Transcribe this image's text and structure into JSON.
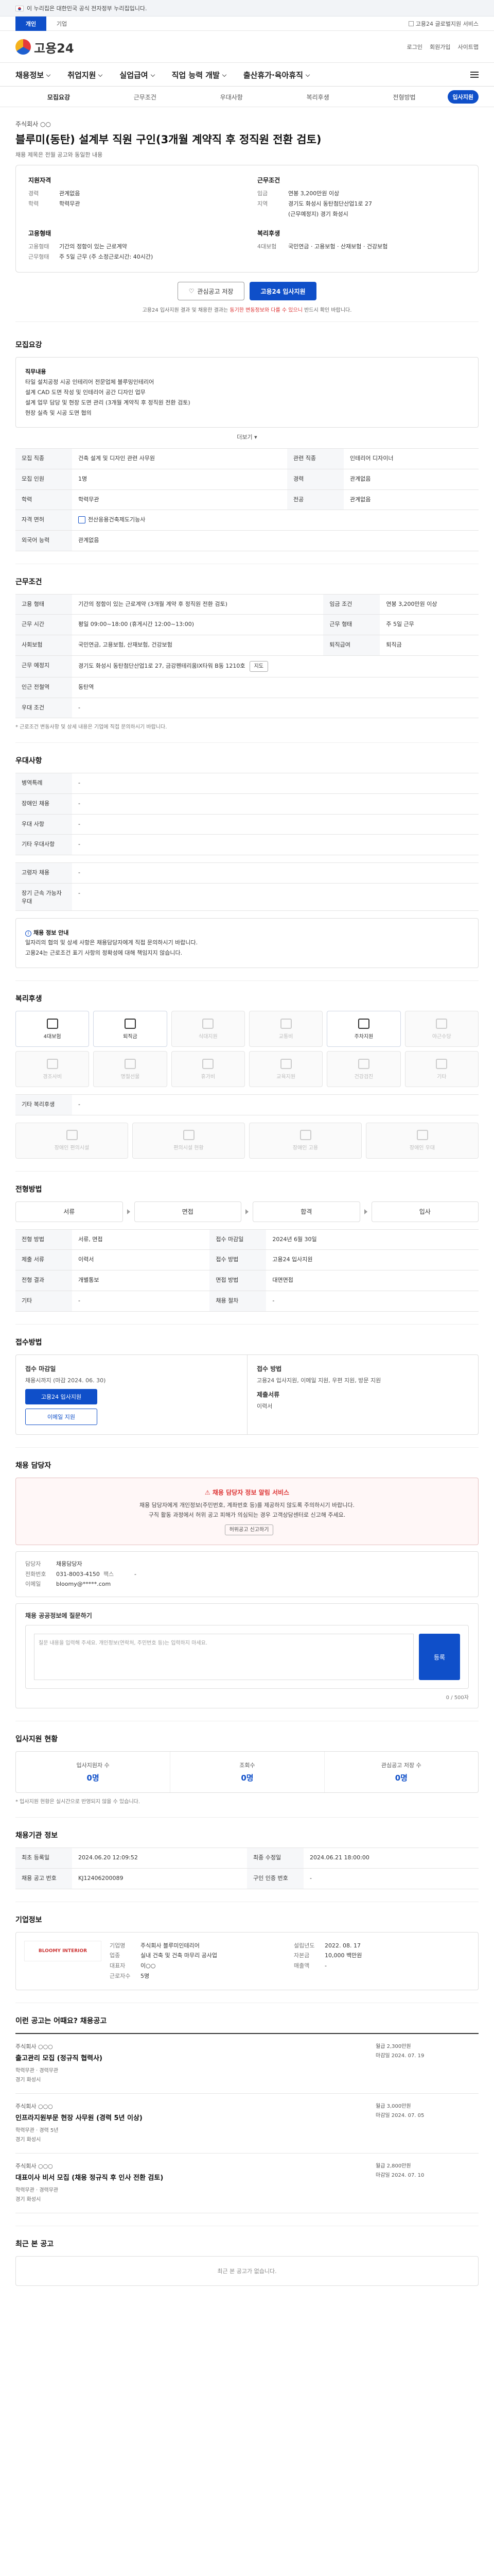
{
  "gov_banner": "이 누리집은 대한민국 공식 전자정부 누리집입니다.",
  "top_tabs": [
    "개인",
    "기업"
  ],
  "top_right": "고용24 글로벌지원 서비스",
  "logo_text": "고용24",
  "header_links": [
    "로그인",
    "회원가입",
    "사이트맵"
  ],
  "gnb": [
    "채용정보",
    "취업지원",
    "실업급여",
    "직업 능력 개발",
    "출산휴가·육아휴직"
  ],
  "sub_tabs": [
    "모집요강",
    "근무조건",
    "우대사항",
    "복리후생",
    "전형방법"
  ],
  "apply_top": "입사지원",
  "company_name": "주식회사 ○○",
  "job_title": "블루미(동탄) 설계부 직원 구인(3개월 계약직 후 정직원 전환 검토)",
  "job_sub": "채용 제목은 전월 공고와 동일한 내용",
  "summary": {
    "left_title": "지원자격",
    "left_rows": [
      {
        "k": "경력",
        "v": "관계없음"
      },
      {
        "k": "학력",
        "v": "학력무관"
      }
    ],
    "right_title": "근무조건",
    "right_rows": [
      {
        "k": "임금",
        "v": "연봉 3,200만원 이상"
      },
      {
        "k": "지역",
        "v": "경기도 화성시 동탄첨단산업1로 27"
      },
      {
        "k": "",
        "v": "(근무예정지) 경기 화성시"
      }
    ],
    "left_title2": "고용형태",
    "left_rows2": [
      {
        "k": "고용형태",
        "v": "기간의 정함이 있는 근로계약"
      },
      {
        "k": "근무형태",
        "v": "주 5일 근무 (주 소정근로시간: 40시간)"
      }
    ],
    "right_title2": "복리후생",
    "right_rows2": [
      {
        "k": "4대보험",
        "v": "국민연금 · 고용보험 · 산재보험 · 건강보험"
      }
    ]
  },
  "btn_scrap": "관심공고 저장",
  "btn_apply": "고용24 입사지원",
  "notice_line": "고용24 입사지원 결과 및 채용한 결과는 ",
  "notice_red": "동기한 변동정보와 다를 수 있으니",
  "notice_tail": " 반드시 확인 바랍니다.",
  "sections": {
    "recruit": "모집요강",
    "work": "근무조건",
    "pref": "우대사항",
    "welfare": "복리후생",
    "process": "전형방법",
    "apply": "접수방법",
    "caution": "채용 담당자",
    "stats": "입사지원 현황",
    "info": "채용기관 정보",
    "company": "기업정보",
    "similar": "이런 공고는 어때요? 채용공고",
    "recent": "최근 본 공고"
  },
  "duty": {
    "heading": "직무내용",
    "lines": [
      "타일 설치공정 시공 인테리어 전문업체 블루밍인테리어",
      "설계 CAD 도면 작성 및 인테리어 공간 디자인 업무",
      "설계 업무 담당 및 현장 도면 관리 (3개월 계약직 후 정직원 전환 검토)",
      "현장 실측 및 시공 도면 협의"
    ],
    "more": "더보기"
  },
  "recruit_table": [
    {
      "k": "모집 직종",
      "v": "건축 설계 및 디자인 관련 사무원"
    },
    {
      "k": "관련 직종",
      "v": "인테리어 디자이너"
    },
    {
      "k": "모집 인원",
      "v": "1명"
    },
    {
      "k": "경력",
      "v": "관계없음"
    },
    {
      "k": "학력",
      "v": "학력무관"
    },
    {
      "k": "전공",
      "v": "관계없음"
    },
    {
      "k": "자격 면허",
      "v": "전산응용건축제도기능사"
    },
    {
      "k": "외국어 능력",
      "v": "관계없음"
    }
  ],
  "work_table": [
    {
      "k": "고용 형태",
      "v": "기간의 정함이 있는 근로계약 (3개월 계약 후 정직원 전환 검토)"
    },
    {
      "k": "임금 조건",
      "v": "연봉 3,200만원 이상"
    },
    {
      "k": "근무 시간",
      "v": "평일 09:00~18:00 (휴게시간 12:00~13:00)"
    },
    {
      "k": "근무 형태",
      "v": "주 5일 근무"
    },
    {
      "k": "사회보험",
      "v": "국민연금, 고용보험, 산재보험, 건강보험"
    },
    {
      "k": "퇴직급여",
      "v": "퇴직금"
    },
    {
      "k": "근무 예정지",
      "v": "경기도 화성시 동탄첨단산업1로 27, 금강펜테리움IX타워 B동 1210호"
    },
    {
      "k": "인근 전철역",
      "v": "동탄역"
    },
    {
      "k": "우대 조건",
      "v": "-"
    }
  ],
  "work_note": "* 근로조건 변동사항 및 상세 내용은 기업에 직접 문의하시기 바랍니다.",
  "map_btn": "지도",
  "pref_table": [
    {
      "k": "병역특례",
      "v": "-"
    },
    {
      "k": "장애인 채용",
      "v": "-"
    },
    {
      "k": "우대 사항",
      "v": "-"
    },
    {
      "k": "기타 우대사항",
      "v": "-"
    }
  ],
  "pref2_table": [
    {
      "k": "고령자 채용",
      "v": "-"
    },
    {
      "k": "장기 근속 가능자 우대",
      "v": "-"
    }
  ],
  "info_notice": {
    "title": "채용 정보 안내",
    "line1": "일자리의 협의 및 상세 사항은 채용담당자에게 직접 문의하시기 바랍니다.",
    "line2": "고용24는 근로조건 표기 사항의 정확성에 대해 책임지지 않습니다."
  },
  "welfare_icons": [
    {
      "label": "4대보험",
      "on": true
    },
    {
      "label": "퇴직금",
      "on": true
    },
    {
      "label": "식대지원",
      "on": false
    },
    {
      "label": "교통비",
      "on": false
    },
    {
      "label": "주차지원",
      "on": true
    },
    {
      "label": "야근수당",
      "on": false
    },
    {
      "label": "경조사비",
      "on": false
    },
    {
      "label": "명절선물",
      "on": false
    },
    {
      "label": "휴가비",
      "on": false
    },
    {
      "label": "교육지원",
      "on": false
    },
    {
      "label": "건강검진",
      "on": false
    },
    {
      "label": "기타",
      "on": false
    }
  ],
  "welfare_extra": "기타 복리후생",
  "welfare_extra_v": "-",
  "disabled_icons": [
    {
      "label": "장애인 편의시설",
      "on": false
    },
    {
      "label": "편의시설 현황",
      "on": false
    },
    {
      "label": "장애인 고용",
      "on": false
    },
    {
      "label": "장애인 우대",
      "on": false
    }
  ],
  "process_steps": [
    "서류",
    "면접",
    "합격",
    "입사"
  ],
  "process_table": [
    {
      "k": "전형 방법",
      "v": "서류, 면접"
    },
    {
      "k": "접수 마감일",
      "v": "2024년 6월 30일"
    },
    {
      "k": "제출 서류",
      "v": "이력서"
    },
    {
      "k": "접수 방법",
      "v": "고용24 입사지원"
    },
    {
      "k": "전형 결과",
      "v": "개별통보"
    },
    {
      "k": "면접 방법",
      "v": "대면면접"
    },
    {
      "k": "기타",
      "v": "-"
    },
    {
      "k": "채용 절차",
      "v": "-"
    }
  ],
  "apply_method": {
    "left_title": "접수 마감일",
    "left_text": "채용시까지 (마감 2024. 06. 30)",
    "btn1": "고용24 입사지원",
    "btn2": "이메일 지원",
    "right_title": "접수 방법",
    "right_text": "고용24 입사지원, 이메일 지원, 우편 지원, 방문 지원",
    "right_sub": "제출서류",
    "right_sub_v": "이력서"
  },
  "caution": {
    "title": "채용 담당자 정보 알림 서비스",
    "lines": [
      "채용 담당자에게 개인정보(주민번호, 계좌번호 등)를 제공하지 않도록 주의하시기 바랍니다.",
      "구직 활동 과정에서 허위 공고 피해가 의심되는 경우 고객상담센터로 신고해 주세요."
    ],
    "btn": "허위공고 신고하기"
  },
  "contact": {
    "name_k": "담당자",
    "name_v": "채용담당자",
    "tel_k": "전화번호",
    "tel_v": "031-8003-4150",
    "fax_k": "팩스",
    "fax_v": "-",
    "email_k": "이메일",
    "email_v": "bloomy@*****.com"
  },
  "comment": {
    "title": "채용 공공정보에 질문하기",
    "placeholder": "질문 내용을 입력해 주세요. 개인정보(연락처, 주민번호 등)는 입력하지 마세요.",
    "count": "0 / 500자",
    "submit": "등록"
  },
  "stats": [
    {
      "label": "입사지원자 수",
      "value": "0명"
    },
    {
      "label": "조회수",
      "value": "0명"
    },
    {
      "label": "관심공고 저장 수",
      "value": "0명"
    }
  ],
  "stats_note": "* 입사지원 현황은 실시간으로 반영되지 않을 수 있습니다.",
  "info_table": [
    {
      "k": "최초 등록일",
      "v": "2024.06.20 12:09:52"
    },
    {
      "k": "최종 수정일",
      "v": "2024.06.21 18:00:00"
    },
    {
      "k": "채용 공고 번호",
      "v": "KJ12406200089"
    },
    {
      "k": "구인 인증 번호",
      "v": "-"
    }
  ],
  "company": {
    "logo_text": "BLOOMY INTERIOR",
    "rows": [
      {
        "k": "기업명",
        "v": "주식회사 블루미인테리어"
      },
      {
        "k": "업종",
        "v": "실내 건축 및 건축 마무리 공사업"
      },
      {
        "k": "대표자",
        "v": "이○○"
      },
      {
        "k": "근로자수",
        "v": "5명"
      },
      {
        "k": "설립년도",
        "v": "2022. 08. 17"
      },
      {
        "k": "자본금",
        "v": "10,000 백만원"
      },
      {
        "k": "매출액",
        "v": "-"
      }
    ]
  },
  "similar_jobs": [
    {
      "company": "주식회사 ○○○",
      "title": "출고관리 모집 (정규직 협력사)",
      "meta1": "학력무관 · 경력무관",
      "meta2": "경기 화성시",
      "right1": "월급 2,300만원",
      "right2": "마감일 2024. 07. 19"
    },
    {
      "company": "주식회사 ○○○",
      "title": "인프라지원부문 현장 사무원 (경력 5년 이상)",
      "meta1": "학력무관 · 경력 5년",
      "meta2": "경기 화성시",
      "right1": "월급 3,000만원",
      "right2": "마감일 2024. 07. 05"
    },
    {
      "company": "주식회사 ○○○",
      "title": "대표이사 비서 모집 (채용 정규직 후 인사 전환 검토)",
      "meta1": "학력무관 · 경력무관",
      "meta2": "경기 화성시",
      "right1": "월급 2,800만원",
      "right2": "마감일 2024. 07. 10"
    }
  ],
  "recent_empty": "최근 본 공고가 없습니다."
}
